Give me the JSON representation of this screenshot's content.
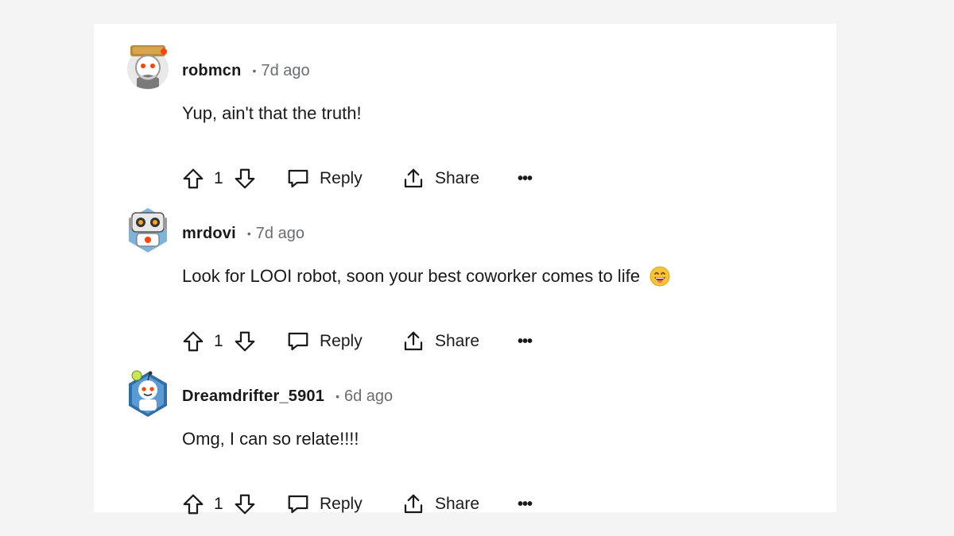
{
  "comments": [
    {
      "username": "robmcn",
      "separator": "•",
      "time": "7d ago",
      "text": "Yup, ain't that the truth!",
      "emoji": "",
      "vote_count": "1",
      "reply_label": "Reply",
      "share_label": "Share",
      "more_label": "•••"
    },
    {
      "username": "mrdovi",
      "separator": "•",
      "time": "7d ago",
      "text": "Look for LOOI robot, soon your best coworker comes to life",
      "emoji": "grinning-face-emoji",
      "vote_count": "1",
      "reply_label": "Reply",
      "share_label": "Share",
      "more_label": "•••"
    },
    {
      "username": "Dreamdrifter_5901",
      "separator": "•",
      "time": "6d ago",
      "text": "Omg, I can so relate!!!!",
      "emoji": "",
      "vote_count": "1",
      "reply_label": "Reply",
      "share_label": "Share",
      "more_label": "•••"
    }
  ],
  "icons": {
    "upvote": "upvote-arrow-icon",
    "downvote": "downvote-arrow-icon",
    "reply": "speech-bubble-icon",
    "share": "share-upload-icon",
    "more": "more-horizontal-icon"
  }
}
